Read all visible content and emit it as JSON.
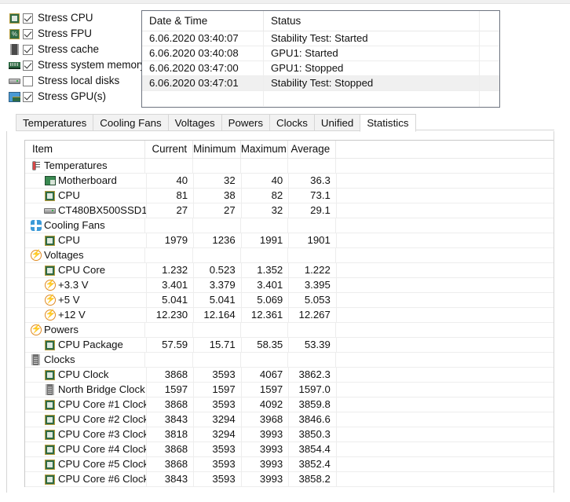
{
  "stress_options": [
    {
      "label": "Stress CPU",
      "icon": "cpu-icon",
      "checked": true
    },
    {
      "label": "Stress FPU",
      "icon": "fpu-icon",
      "checked": true
    },
    {
      "label": "Stress cache",
      "icon": "cache-icon",
      "checked": true
    },
    {
      "label": "Stress system memory",
      "icon": "memory-icon",
      "checked": true
    },
    {
      "label": "Stress local disks",
      "icon": "disk-icon",
      "checked": false
    },
    {
      "label": "Stress GPU(s)",
      "icon": "gpu-icon",
      "checked": true
    }
  ],
  "log": {
    "columns": [
      "Date & Time",
      "Status"
    ],
    "rows": [
      {
        "datetime": "6.06.2020 03:40:07",
        "status": "Stability Test: Started",
        "selected": false
      },
      {
        "datetime": "6.06.2020 03:40:08",
        "status": "GPU1: Started",
        "selected": false
      },
      {
        "datetime": "6.06.2020 03:47:00",
        "status": "GPU1: Stopped",
        "selected": false
      },
      {
        "datetime": "6.06.2020 03:47:01",
        "status": "Stability Test: Stopped",
        "selected": true
      }
    ]
  },
  "tabs": [
    {
      "label": "Temperatures",
      "active": false
    },
    {
      "label": "Cooling Fans",
      "active": false
    },
    {
      "label": "Voltages",
      "active": false
    },
    {
      "label": "Powers",
      "active": false
    },
    {
      "label": "Clocks",
      "active": false
    },
    {
      "label": "Unified",
      "active": false
    },
    {
      "label": "Statistics",
      "active": true
    }
  ],
  "statistics": {
    "columns": [
      "Item",
      "Current",
      "Minimum",
      "Maximum",
      "Average"
    ],
    "rows": [
      {
        "type": "group",
        "icon": "thermometer-icon",
        "label": "Temperatures",
        "current": "",
        "minimum": "",
        "maximum": "",
        "average": ""
      },
      {
        "type": "child",
        "icon": "motherboard-icon",
        "label": "Motherboard",
        "current": "40",
        "minimum": "32",
        "maximum": "40",
        "average": "36.3"
      },
      {
        "type": "child",
        "icon": "cpu-icon",
        "label": "CPU",
        "current": "81",
        "minimum": "38",
        "maximum": "82",
        "average": "73.1"
      },
      {
        "type": "child",
        "icon": "disk-icon",
        "label": "CT480BX500SSD1",
        "current": "27",
        "minimum": "27",
        "maximum": "32",
        "average": "29.1"
      },
      {
        "type": "group",
        "icon": "fan-icon",
        "label": "Cooling Fans",
        "current": "",
        "minimum": "",
        "maximum": "",
        "average": ""
      },
      {
        "type": "child",
        "icon": "cpu-icon",
        "label": "CPU",
        "current": "1979",
        "minimum": "1236",
        "maximum": "1991",
        "average": "1901"
      },
      {
        "type": "group",
        "icon": "voltage-icon",
        "label": "Voltages",
        "current": "",
        "minimum": "",
        "maximum": "",
        "average": ""
      },
      {
        "type": "child",
        "icon": "cpu-icon",
        "label": "CPU Core",
        "current": "1.232",
        "minimum": "0.523",
        "maximum": "1.352",
        "average": "1.222"
      },
      {
        "type": "child",
        "icon": "voltage-icon",
        "label": "+3.3 V",
        "current": "3.401",
        "minimum": "3.379",
        "maximum": "3.401",
        "average": "3.395"
      },
      {
        "type": "child",
        "icon": "voltage-icon",
        "label": "+5 V",
        "current": "5.041",
        "minimum": "5.041",
        "maximum": "5.069",
        "average": "5.053"
      },
      {
        "type": "child",
        "icon": "voltage-icon",
        "label": "+12 V",
        "current": "12.230",
        "minimum": "12.164",
        "maximum": "12.361",
        "average": "12.267"
      },
      {
        "type": "group",
        "icon": "voltage-icon",
        "label": "Powers",
        "current": "",
        "minimum": "",
        "maximum": "",
        "average": ""
      },
      {
        "type": "child",
        "icon": "cpu-icon",
        "label": "CPU Package",
        "current": "57.59",
        "minimum": "15.71",
        "maximum": "58.35",
        "average": "53.39"
      },
      {
        "type": "group",
        "icon": "clock-icon",
        "label": "Clocks",
        "current": "",
        "minimum": "",
        "maximum": "",
        "average": ""
      },
      {
        "type": "child",
        "icon": "cpu-icon",
        "label": "CPU Clock",
        "current": "3868",
        "minimum": "3593",
        "maximum": "4067",
        "average": "3862.3"
      },
      {
        "type": "child",
        "icon": "clock-icon",
        "label": "North Bridge Clock",
        "current": "1597",
        "minimum": "1597",
        "maximum": "1597",
        "average": "1597.0"
      },
      {
        "type": "child",
        "icon": "cpu-icon",
        "label": "CPU Core #1 Clock",
        "current": "3868",
        "minimum": "3593",
        "maximum": "4092",
        "average": "3859.8"
      },
      {
        "type": "child",
        "icon": "cpu-icon",
        "label": "CPU Core #2 Clock",
        "current": "3843",
        "minimum": "3294",
        "maximum": "3968",
        "average": "3846.6"
      },
      {
        "type": "child",
        "icon": "cpu-icon",
        "label": "CPU Core #3 Clock",
        "current": "3818",
        "minimum": "3294",
        "maximum": "3993",
        "average": "3850.3"
      },
      {
        "type": "child",
        "icon": "cpu-icon",
        "label": "CPU Core #4 Clock",
        "current": "3868",
        "minimum": "3593",
        "maximum": "3993",
        "average": "3854.4"
      },
      {
        "type": "child",
        "icon": "cpu-icon",
        "label": "CPU Core #5 Clock",
        "current": "3868",
        "minimum": "3593",
        "maximum": "3993",
        "average": "3852.4"
      },
      {
        "type": "child",
        "icon": "cpu-icon",
        "label": "CPU Core #6 Clock",
        "current": "3843",
        "minimum": "3593",
        "maximum": "3993",
        "average": "3858.2"
      }
    ]
  },
  "colors": {
    "selection": "#f0f0f0",
    "panel_border": "#6e7480",
    "grid": "#ededed",
    "cpu_green": "#2f6b45",
    "fan_blue": "#3c9ad8",
    "voltage_orange": "#e08a22",
    "thermo_red": "#d64545"
  }
}
